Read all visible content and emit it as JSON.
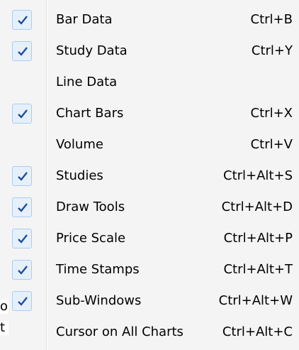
{
  "menu": {
    "items": [
      {
        "label": "Bar Data",
        "shortcut": "Ctrl+B",
        "checked": true
      },
      {
        "label": "Study Data",
        "shortcut": "Ctrl+Y",
        "checked": true
      },
      {
        "label": "Line Data",
        "shortcut": "",
        "checked": false
      },
      {
        "label": "Chart Bars",
        "shortcut": "Ctrl+X",
        "checked": true
      },
      {
        "label": "Volume",
        "shortcut": "Ctrl+V",
        "checked": false
      },
      {
        "label": "Studies",
        "shortcut": "Ctrl+Alt+S",
        "checked": true
      },
      {
        "label": "Draw Tools",
        "shortcut": "Ctrl+Alt+D",
        "checked": true
      },
      {
        "label": "Price Scale",
        "shortcut": "Ctrl+Alt+P",
        "checked": true
      },
      {
        "label": "Time Stamps",
        "shortcut": "Ctrl+Alt+T",
        "checked": true
      },
      {
        "label": "Sub-Windows",
        "shortcut": "Ctrl+Alt+W",
        "checked": true
      },
      {
        "label": "Cursor on All Charts",
        "shortcut": "Ctrl+Alt+C",
        "checked": false
      }
    ]
  },
  "background_fragments": [
    "o",
    "t"
  ],
  "colors": {
    "menu_background": "#f4f4f4",
    "check_highlight": "#e6f0fa",
    "check_border": "#a8cdf2",
    "check_mark": "#1e4e9c"
  },
  "icons": {
    "check": "checkmark-icon"
  }
}
